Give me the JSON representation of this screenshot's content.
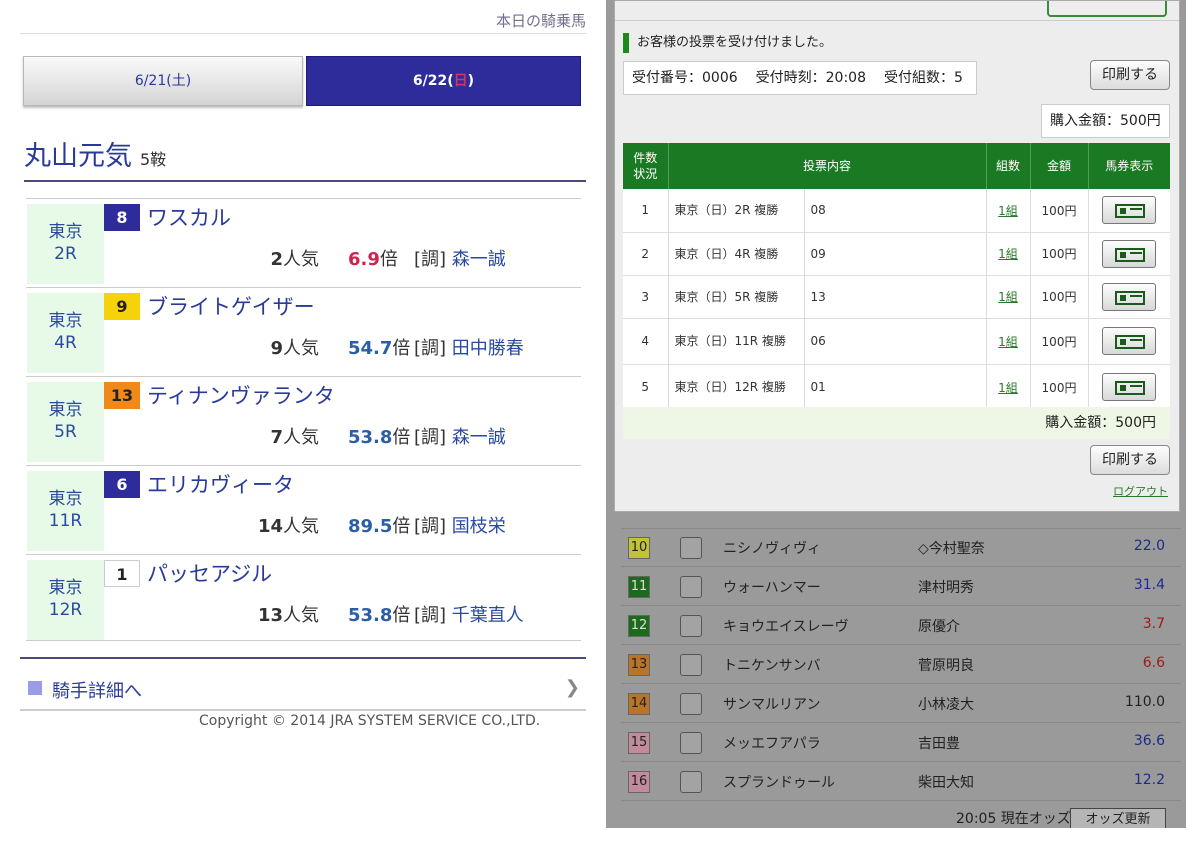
{
  "left": {
    "header_link": "本日の騎乗馬",
    "tabs": [
      {
        "date": "6/21(",
        "dow": "土",
        "close": ")"
      },
      {
        "date": "6/22(",
        "dow": "日",
        "close": ")"
      }
    ],
    "jockey_name": "丸山元気",
    "rides": "5鞍",
    "popularity_suffix": "人気",
    "odds_suffix": "倍",
    "trainer_prefix": "[調]",
    "races": [
      {
        "track": "東京",
        "race": "2R",
        "num": "8",
        "horse": "ワスカル",
        "pop": "2",
        "odds": "6.9",
        "trainer": "森一誠",
        "box_bg": "#2e2c9a",
        "box_fg": "#ffffff",
        "favorite": true
      },
      {
        "track": "東京",
        "race": "4R",
        "num": "9",
        "horse": "ブライトゲイザー",
        "pop": "9",
        "odds": "54.7",
        "trainer": "田中勝春",
        "box_bg": "#f5d20a",
        "box_fg": "#222222",
        "favorite": false
      },
      {
        "track": "東京",
        "race": "5R",
        "num": "13",
        "horse": "ティナンヴァランタ",
        "pop": "7",
        "odds": "53.8",
        "trainer": "森一誠",
        "box_bg": "#f0881a",
        "box_fg": "#222222",
        "favorite": false
      },
      {
        "track": "東京",
        "race": "11R",
        "num": "6",
        "horse": "エリカヴィータ",
        "pop": "14",
        "odds": "89.5",
        "trainer": "国枝栄",
        "box_bg": "#2e2c9a",
        "box_fg": "#ffffff",
        "favorite": false
      },
      {
        "track": "東京",
        "race": "12R",
        "num": "1",
        "horse": "パッセアジル",
        "pop": "13",
        "odds": "53.8",
        "trainer": "千葉直人",
        "box_bg": "#ffffff",
        "box_fg": "#222222",
        "favorite": false
      }
    ],
    "detail_link": "騎手詳細へ",
    "copyright": "Copyright © 2014 JRA SYSTEM SERVICE CO.,LTD."
  },
  "right": {
    "modal": {
      "message": "お客様の投票を受け付けました。",
      "receipt_no": "受付番号：0006",
      "receipt_time": "受付時刻：20:08",
      "receipt_count": "受付組数：5",
      "print_label": "印刷する",
      "total_label": "購入金額：500円",
      "table_headers": {
        "no": "件数\n状況",
        "content": "投票内容",
        "kumi": "組数",
        "amount": "金額",
        "show": "馬券表示"
      },
      "bets": [
        {
          "no": "1",
          "race": "東京（日）2R 複勝",
          "horse": "08",
          "kumi": "1組",
          "amount": "100円"
        },
        {
          "no": "2",
          "race": "東京（日）4R 複勝",
          "horse": "09",
          "kumi": "1組",
          "amount": "100円"
        },
        {
          "no": "3",
          "race": "東京（日）5R 複勝",
          "horse": "13",
          "kumi": "1組",
          "amount": "100円"
        },
        {
          "no": "4",
          "race": "東京（日）11R 複勝",
          "horse": "06",
          "kumi": "1組",
          "amount": "100円"
        },
        {
          "no": "5",
          "race": "東京（日）12R 複勝",
          "horse": "01",
          "kumi": "1組",
          "amount": "100円"
        }
      ],
      "logout": "ログアウト"
    },
    "odds_rows": [
      {
        "num": "10",
        "color": "#c2c23a",
        "text": "#222222",
        "horse": "ニシノヴィヴィ",
        "jockey": "◇今村聖奈",
        "odds": "22.0",
        "odds_class": "blue"
      },
      {
        "num": "11",
        "color": "#1c6a1c",
        "text": "#dddddd",
        "horse": "ウォーハンマー",
        "jockey": "津村明秀",
        "odds": "31.4",
        "odds_class": "blue"
      },
      {
        "num": "12",
        "color": "#1c6a1c",
        "text": "#dddddd",
        "horse": "キョウエイスレーヴ",
        "jockey": "原優介",
        "odds": "3.7",
        "odds_class": "red"
      },
      {
        "num": "13",
        "color": "#b8742a",
        "text": "#222222",
        "horse": "トニケンサンバ",
        "jockey": "菅原明良",
        "odds": "6.6",
        "odds_class": "red"
      },
      {
        "num": "14",
        "color": "#b8742a",
        "text": "#222222",
        "horse": "サンマルリアン",
        "jockey": "小林凌大",
        "odds": "110.0",
        "odds_class": "dark"
      },
      {
        "num": "15",
        "color": "#c28a9a",
        "text": "#222222",
        "horse": "メッエフアパラ",
        "jockey": "吉田豊",
        "odds": "36.6",
        "odds_class": "blue"
      },
      {
        "num": "16",
        "color": "#c28a9a",
        "text": "#222222",
        "horse": "スプランドゥール",
        "jockey": "柴田大知",
        "odds": "12.2",
        "odds_class": "blue"
      }
    ],
    "odds_time": "20:05 現在オッズ",
    "odds_update": "オッズ更新"
  }
}
